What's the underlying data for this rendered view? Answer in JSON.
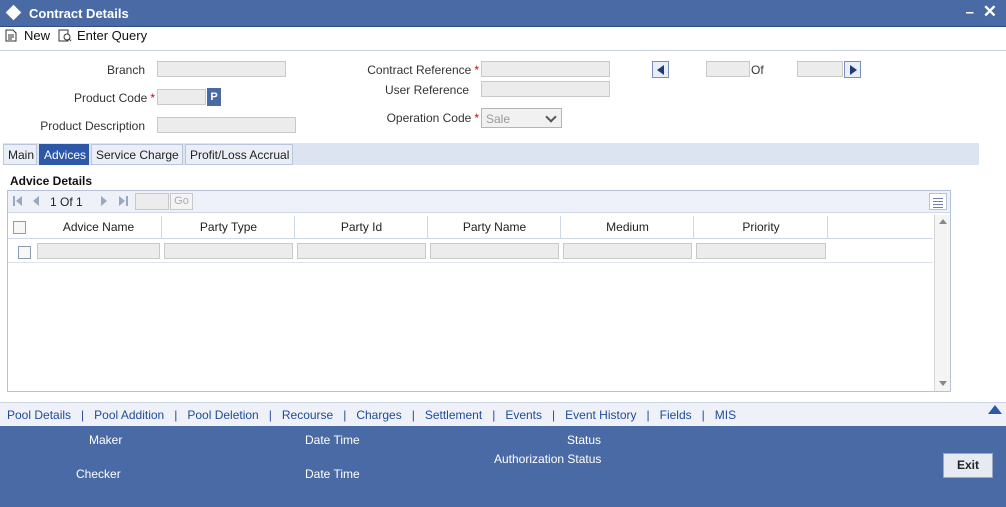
{
  "window": {
    "title": "Contract Details"
  },
  "toolbar": {
    "new_label": "New",
    "enter_query_label": "Enter Query"
  },
  "form": {
    "branch_label": "Branch",
    "product_code_label": "Product Code",
    "product_description_label": "Product Description",
    "contract_reference_label": "Contract Reference",
    "user_reference_label": "User Reference",
    "operation_code_label": "Operation Code",
    "operation_code_value": "Sale",
    "of_label": "Of",
    "required_marker": "*",
    "p_button_label": "P"
  },
  "tabs": [
    {
      "label": "Main"
    },
    {
      "label": "Advices"
    },
    {
      "label": "Service Charge"
    },
    {
      "label": "Profit/Loss Accrual"
    }
  ],
  "active_tab": "Advices",
  "advice_details": {
    "title": "Advice Details",
    "pager": {
      "text": "1 Of 1",
      "go_label": "Go"
    },
    "columns": [
      "Advice Name",
      "Party Type",
      "Party Id",
      "Party Name",
      "Medium",
      "Priority"
    ]
  },
  "links": [
    "Pool Details",
    "Pool Addition",
    "Pool Deletion",
    "Recourse",
    "Charges",
    "Settlement",
    "Events",
    "Event History",
    "Fields",
    "MIS"
  ],
  "footer": {
    "maker_label": "Maker",
    "checker_label": "Checker",
    "date_time_label": "Date Time",
    "status_label": "Status",
    "authorization_status_label": "Authorization Status",
    "exit_label": "Exit"
  },
  "colors": {
    "header_blue": "#4a6aa5",
    "active_tab": "#2d58a8",
    "link_blue": "#1f4aa0",
    "required_red": "#cc0000"
  }
}
